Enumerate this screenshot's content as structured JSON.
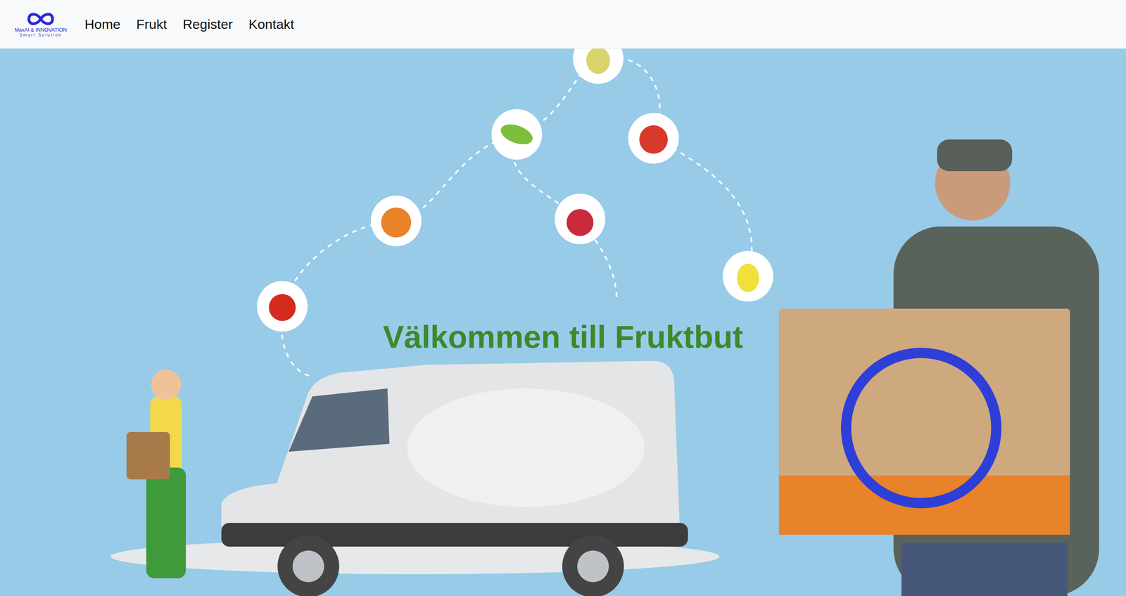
{
  "logo": {
    "title": "MaxAI & INNOVATION",
    "subtitle": "Smart Solution"
  },
  "nav": [
    {
      "label": "Home"
    },
    {
      "label": "Frukt"
    },
    {
      "label": "Register"
    },
    {
      "label": "Kontakt"
    }
  ],
  "hero": {
    "heading": "Välkommen till Fruktbut"
  }
}
